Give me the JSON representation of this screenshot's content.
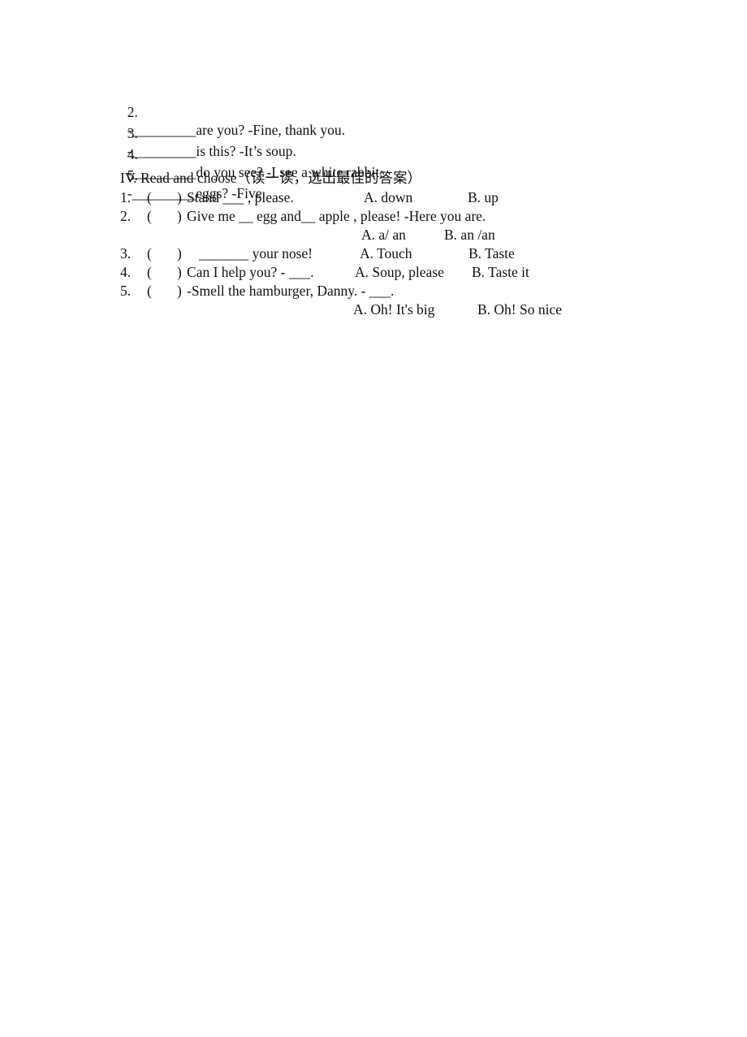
{
  "fill_in": {
    "items": [
      {
        "number": "2.",
        "prefix": "-",
        "blank": "_________",
        "text": "are you? -Fine, thank you."
      },
      {
        "number": "3.",
        "prefix": "-",
        "blank": "_________",
        "text": "is this? -It’s soup."
      },
      {
        "number": "4.",
        "prefix": "-",
        "blank": "_________",
        "text": "do you see? -I see a white rabbit."
      },
      {
        "number": "5.",
        "prefix": "-",
        "blank": "_________",
        "text": "eggs? -Five."
      }
    ]
  },
  "section_iv": {
    "title": "IV. Read and choose（读一读，选出最佳的答案）",
    "questions": [
      {
        "number": "1.",
        "paren_open": "(",
        "paren_close": ")",
        "stem": "Stand ___ , please.",
        "option_a": "A. down",
        "option_b": "B. up"
      },
      {
        "number": "2.",
        "paren_open": "(",
        "paren_close": ")",
        "stem": "Give me __ egg and__ apple , please! -Here you are.",
        "option_a": "A. a/ an",
        "option_b": "B. an /an"
      },
      {
        "number": "3.",
        "paren_open": "(",
        "paren_close": ")",
        "stem": "_______ your nose!",
        "option_a": "A. Touch",
        "option_b": "B. Taste"
      },
      {
        "number": "4.",
        "paren_open": "(",
        "paren_close": ")",
        "stem": "Can I help you? - ___.",
        "option_a": "A. Soup, please",
        "option_b": "B. Taste it"
      },
      {
        "number": "5.",
        "paren_open": "(",
        "paren_close": ")",
        "stem": "-Smell the hamburger, Danny. - ___.",
        "option_a": "A. Oh! It's big",
        "option_b": "B. Oh! So nice"
      }
    ]
  }
}
